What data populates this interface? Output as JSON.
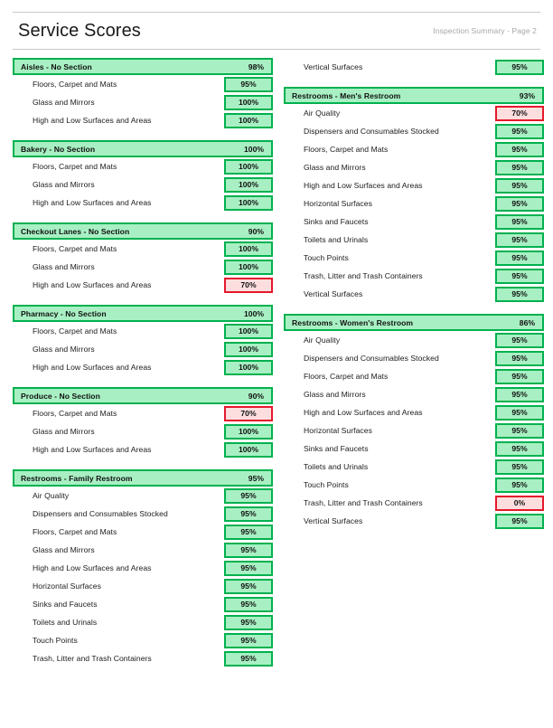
{
  "header": {
    "title": "Service Scores",
    "meta": "Inspection Summary - Page 2"
  },
  "colors": {
    "green_border": "#00b14f",
    "green_fill": "#a8f0c3",
    "red_border": "#e4182b",
    "red_fill": "#fcdedf",
    "rule": "#c9c9c9"
  },
  "columns": [
    {
      "orphan_items": [],
      "sections": [
        {
          "title": "Aisles - No Section",
          "score": "98%",
          "status": "ok",
          "items": [
            {
              "label": "Floors, Carpet and Mats",
              "score": "95%",
              "status": "ok"
            },
            {
              "label": "Glass and Mirrors",
              "score": "100%",
              "status": "ok"
            },
            {
              "label": "High and Low Surfaces and Areas",
              "score": "100%",
              "status": "ok"
            }
          ]
        },
        {
          "title": "Bakery - No Section",
          "score": "100%",
          "status": "ok",
          "items": [
            {
              "label": "Floors, Carpet and Mats",
              "score": "100%",
              "status": "ok"
            },
            {
              "label": "Glass and Mirrors",
              "score": "100%",
              "status": "ok"
            },
            {
              "label": "High and Low Surfaces and Areas",
              "score": "100%",
              "status": "ok"
            }
          ]
        },
        {
          "title": "Checkout Lanes - No Section",
          "score": "90%",
          "status": "ok",
          "items": [
            {
              "label": "Floors, Carpet and Mats",
              "score": "100%",
              "status": "ok"
            },
            {
              "label": "Glass and Mirrors",
              "score": "100%",
              "status": "ok"
            },
            {
              "label": "High and Low Surfaces and Areas",
              "score": "70%",
              "status": "low"
            }
          ]
        },
        {
          "title": "Pharmacy - No Section",
          "score": "100%",
          "status": "ok",
          "items": [
            {
              "label": "Floors, Carpet and Mats",
              "score": "100%",
              "status": "ok"
            },
            {
              "label": "Glass and Mirrors",
              "score": "100%",
              "status": "ok"
            },
            {
              "label": "High and Low Surfaces and Areas",
              "score": "100%",
              "status": "ok"
            }
          ]
        },
        {
          "title": "Produce - No Section",
          "score": "90%",
          "status": "ok",
          "items": [
            {
              "label": "Floors, Carpet and Mats",
              "score": "70%",
              "status": "low"
            },
            {
              "label": "Glass and Mirrors",
              "score": "100%",
              "status": "ok"
            },
            {
              "label": "High and Low Surfaces and Areas",
              "score": "100%",
              "status": "ok"
            }
          ]
        },
        {
          "title": "Restrooms - Family Restroom",
          "score": "95%",
          "status": "ok",
          "items": [
            {
              "label": "Air Quality",
              "score": "95%",
              "status": "ok"
            },
            {
              "label": "Dispensers and Consumables Stocked",
              "score": "95%",
              "status": "ok"
            },
            {
              "label": "Floors, Carpet and Mats",
              "score": "95%",
              "status": "ok"
            },
            {
              "label": "Glass and Mirrors",
              "score": "95%",
              "status": "ok"
            },
            {
              "label": "High and Low Surfaces and Areas",
              "score": "95%",
              "status": "ok"
            },
            {
              "label": "Horizontal Surfaces",
              "score": "95%",
              "status": "ok"
            },
            {
              "label": "Sinks and Faucets",
              "score": "95%",
              "status": "ok"
            },
            {
              "label": "Toilets and Urinals",
              "score": "95%",
              "status": "ok"
            },
            {
              "label": "Touch Points",
              "score": "95%",
              "status": "ok"
            },
            {
              "label": "Trash, Litter and Trash Containers",
              "score": "95%",
              "status": "ok"
            }
          ]
        }
      ]
    },
    {
      "orphan_items": [
        {
          "label": "Vertical Surfaces",
          "score": "95%",
          "status": "ok"
        }
      ],
      "sections": [
        {
          "title": "Restrooms - Men's Restroom",
          "score": "93%",
          "status": "ok",
          "items": [
            {
              "label": "Air Quality",
              "score": "70%",
              "status": "low"
            },
            {
              "label": "Dispensers and Consumables Stocked",
              "score": "95%",
              "status": "ok"
            },
            {
              "label": "Floors, Carpet and Mats",
              "score": "95%",
              "status": "ok"
            },
            {
              "label": "Glass and Mirrors",
              "score": "95%",
              "status": "ok"
            },
            {
              "label": "High and Low Surfaces and Areas",
              "score": "95%",
              "status": "ok"
            },
            {
              "label": "Horizontal Surfaces",
              "score": "95%",
              "status": "ok"
            },
            {
              "label": "Sinks and Faucets",
              "score": "95%",
              "status": "ok"
            },
            {
              "label": "Toilets and Urinals",
              "score": "95%",
              "status": "ok"
            },
            {
              "label": "Touch Points",
              "score": "95%",
              "status": "ok"
            },
            {
              "label": "Trash, Litter and Trash Containers",
              "score": "95%",
              "status": "ok"
            },
            {
              "label": "Vertical Surfaces",
              "score": "95%",
              "status": "ok"
            }
          ]
        },
        {
          "title": "Restrooms - Women's Restroom",
          "score": "86%",
          "status": "ok",
          "items": [
            {
              "label": "Air Quality",
              "score": "95%",
              "status": "ok"
            },
            {
              "label": "Dispensers and Consumables Stocked",
              "score": "95%",
              "status": "ok"
            },
            {
              "label": "Floors, Carpet and Mats",
              "score": "95%",
              "status": "ok"
            },
            {
              "label": "Glass and Mirrors",
              "score": "95%",
              "status": "ok"
            },
            {
              "label": "High and Low Surfaces and Areas",
              "score": "95%",
              "status": "ok"
            },
            {
              "label": "Horizontal Surfaces",
              "score": "95%",
              "status": "ok"
            },
            {
              "label": "Sinks and Faucets",
              "score": "95%",
              "status": "ok"
            },
            {
              "label": "Toilets and Urinals",
              "score": "95%",
              "status": "ok"
            },
            {
              "label": "Touch Points",
              "score": "95%",
              "status": "ok"
            },
            {
              "label": "Trash, Litter and Trash Containers",
              "score": "0%",
              "status": "low"
            },
            {
              "label": "Vertical Surfaces",
              "score": "95%",
              "status": "ok"
            }
          ]
        }
      ]
    }
  ]
}
